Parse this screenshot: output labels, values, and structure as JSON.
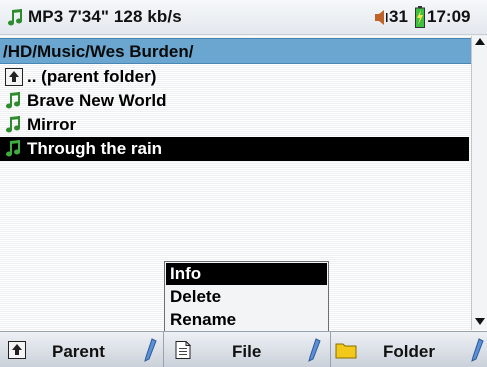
{
  "status_bar": {
    "track_info": "MP3 7'34\" 128 kb/s",
    "volume": "31",
    "clock": "17:09"
  },
  "path_bar": {
    "path": "/HD/Music/Wes Burden/"
  },
  "file_list": {
    "items": [
      {
        "label": ".. (parent folder)",
        "icon": "parent-folder-icon"
      },
      {
        "label": "Brave New World",
        "icon": "music-note-icon"
      },
      {
        "label": "Mirror",
        "icon": "music-note-icon"
      },
      {
        "label": "Through the rain",
        "icon": "music-note-icon",
        "selected": true
      }
    ]
  },
  "context_menu": {
    "items": [
      {
        "label": "Info",
        "active": true
      },
      {
        "label": "Delete"
      },
      {
        "label": "Rename"
      }
    ]
  },
  "toolbar": {
    "parent_label": "Parent",
    "file_label": "File",
    "folder_label": "Folder"
  },
  "colors": {
    "path_bar": "#6aa6d0",
    "selection": "#000000",
    "music_note": "#2e8b2e",
    "folder": "#f2c91a",
    "battery": "#3fbf3f",
    "pen_stylus": "#5b8fd6"
  }
}
